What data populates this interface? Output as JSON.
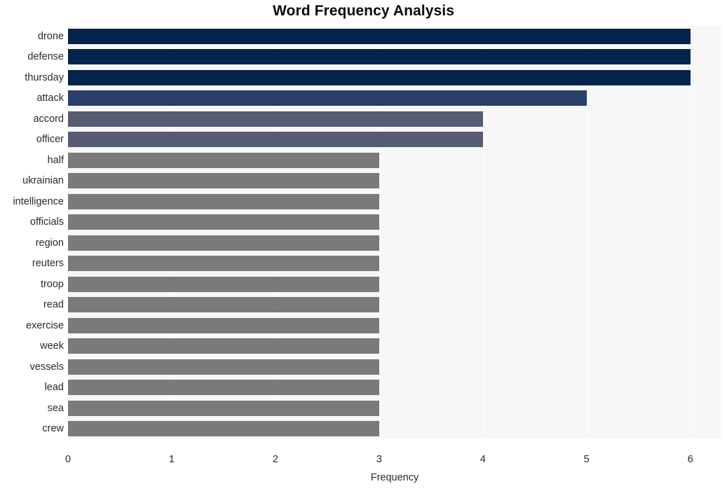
{
  "chart_data": {
    "type": "bar",
    "orientation": "horizontal",
    "title": "Word Frequency Analysis",
    "xlabel": "Frequency",
    "ylabel": "",
    "xlim": [
      0,
      6.3
    ],
    "xticks": [
      0,
      1,
      2,
      3,
      4,
      5,
      6
    ],
    "xtick_labels": [
      "0",
      "1",
      "2",
      "3",
      "4",
      "5",
      "6"
    ],
    "grid": true,
    "grid_axis": "x",
    "legend": false,
    "categories": [
      "drone",
      "defense",
      "thursday",
      "attack",
      "accord",
      "officer",
      "half",
      "ukrainian",
      "intelligence",
      "officials",
      "region",
      "reuters",
      "troop",
      "read",
      "exercise",
      "week",
      "vessels",
      "lead",
      "sea",
      "crew"
    ],
    "values": [
      6,
      6,
      6,
      5,
      4,
      4,
      3,
      3,
      3,
      3,
      3,
      3,
      3,
      3,
      3,
      3,
      3,
      3,
      3,
      3
    ],
    "bar_colors": [
      "#04234d",
      "#04234d",
      "#04234d",
      "#2b3f6b",
      "#565c71",
      "#565c71",
      "#797a79",
      "#797a79",
      "#797a79",
      "#797a79",
      "#797a79",
      "#797a79",
      "#797a79",
      "#797a79",
      "#797a79",
      "#797a79",
      "#797a79",
      "#797a79",
      "#797a79",
      "#797a79"
    ],
    "plot_background": "#f7f7f7",
    "gridline_color": "#ffffff",
    "figure_background": "#ffffff"
  }
}
